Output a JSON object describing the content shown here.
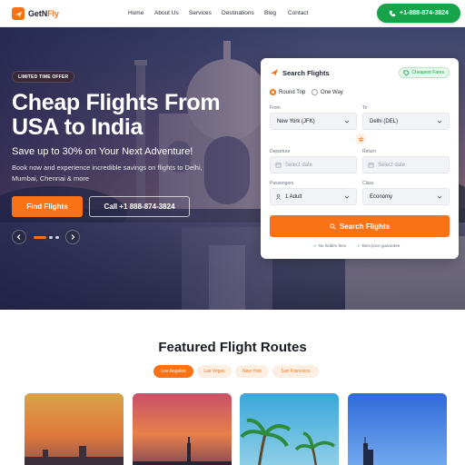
{
  "nav": {
    "brand_part1": "GetN",
    "brand_part2": "Fly",
    "links": [
      "Home",
      "About Us",
      "Services",
      "Destinations",
      "Blog",
      "Contact"
    ],
    "phone_button": "+1-888-874-3824"
  },
  "hero": {
    "badge": "LIMITED TIME OFFER",
    "title": "Cheap Flights From USA to India",
    "subtitle": "Save up to 30% on Your Next Adventure!",
    "description": "Book now and experience incredible savings on flights to Delhi, Mumbai, Chennai & more",
    "find_button": "Find Flights",
    "call_button": "Call +1 888-874-3824",
    "carousel": {
      "slides": 3,
      "active": 1
    }
  },
  "search": {
    "title": "Search Flights",
    "badge": "Cheapest Fares",
    "trip_types": [
      "Round Trip",
      "One Way"
    ],
    "selected_trip": "Round Trip",
    "from_label": "From",
    "from_value": "New York (JFK)",
    "to_label": "To",
    "to_value": "Delhi (DEL)",
    "departure_label": "Departure",
    "departure_placeholder": "Select date",
    "return_label": "Return",
    "return_placeholder": "Select date",
    "passengers_label": "Passengers",
    "passengers_value": "1 Adult",
    "class_label": "Class",
    "class_value": "Economy",
    "button": "Search Flights",
    "guarantees": [
      "No hidden fees",
      "Best price guarantee"
    ]
  },
  "featured": {
    "title": "Featured Flight Routes",
    "filters": [
      "Los Angeles",
      "Las Vegas",
      "New York",
      "San Francisco"
    ],
    "active_filter": "Los Angeles"
  },
  "colors": {
    "accent": "#f97316",
    "call_green": "#16a34a"
  }
}
